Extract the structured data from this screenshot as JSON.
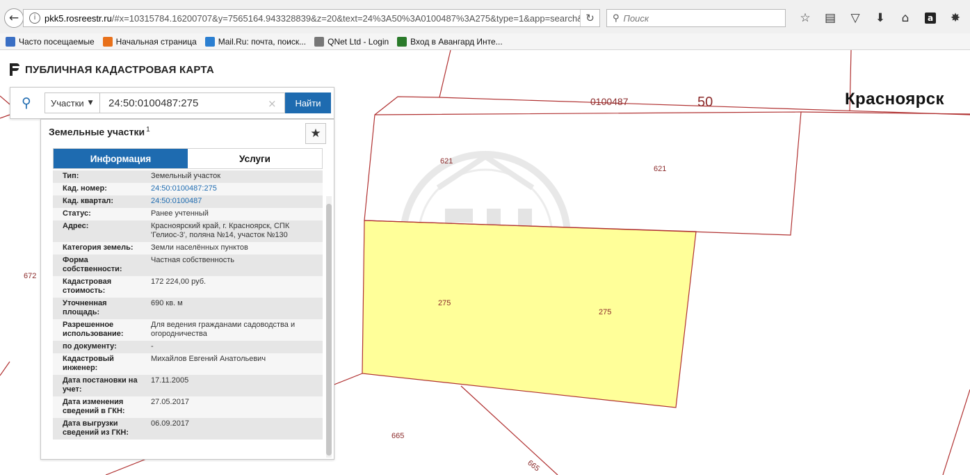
{
  "browser": {
    "url_domain": "pkk5.rosreestr.ru",
    "url_rest": "/#x=10315784.16200707&y=7565164.943328839&z=20&text=24%3A50%3A0100487%3A275&type=1&app=search&o",
    "search_placeholder": "Поиск",
    "bookmarks": [
      {
        "label": "Часто посещаемые",
        "icon": "folder-icon",
        "color": "#3a6fc4"
      },
      {
        "label": "Начальная страница",
        "icon": "firefox-icon",
        "color": "#e8711b"
      },
      {
        "label": "Mail.Ru: почта, поиск...",
        "icon": "mailru-icon",
        "color": "#2b7fd1"
      },
      {
        "label": "QNet Ltd - Login",
        "icon": "globe-icon",
        "color": "#777777"
      },
      {
        "label": "Вход в Авангард Инте...",
        "icon": "bank-icon",
        "color": "#2a7a2a"
      }
    ]
  },
  "app": {
    "title": "ПУБЛИЧНАЯ КАДАСТРОВАЯ КАРТА"
  },
  "search": {
    "type_label": "Участки",
    "query": "24:50:0100487:275",
    "find_label": "Найти"
  },
  "panel": {
    "title": "Земельные участки",
    "count": "1",
    "tabs": [
      "Информация",
      "Услуги"
    ],
    "rows": [
      {
        "key": "Тип:",
        "value": "Земельный участок",
        "link": false
      },
      {
        "key": "Кад. номер:",
        "value": "24:50:0100487:275",
        "link": true
      },
      {
        "key": "Кад. квартал:",
        "value": "24:50:0100487",
        "link": true
      },
      {
        "key": "Статус:",
        "value": "Ранее учтенный",
        "link": false
      },
      {
        "key": "Адрес:",
        "value": "Красноярский край, г. Красноярск, СПК 'Гелиос-3', поляна №14, участок №130",
        "link": false
      },
      {
        "key": "Категория земель:",
        "value": "Земли населённых пунктов",
        "link": false
      },
      {
        "key": "Форма собственности:",
        "value": "Частная собственность",
        "link": false
      },
      {
        "key": "Кадастровая стоимость:",
        "value": "172 224,00 руб.",
        "link": false
      },
      {
        "key": "Уточненная площадь:",
        "value": "690 кв. м",
        "link": false
      },
      {
        "key": "Разрешенное использование:",
        "value": "Для ведения гражданами садоводства и огородничества",
        "link": false
      },
      {
        "key": "по документу:",
        "value": "-",
        "link": false
      },
      {
        "key": "Кадастровый инженер:",
        "value": "Михайлов Евгений Анатольевич",
        "link": false
      },
      {
        "key": "Дата постановки на учет:",
        "value": "17.11.2005",
        "link": false
      },
      {
        "key": "Дата изменения сведений в ГКН:",
        "value": "27.05.2017",
        "link": false
      },
      {
        "key": "Дата выгрузки сведений из ГКН:",
        "value": "06.09.2017",
        "link": false
      }
    ]
  },
  "map": {
    "quarter_label": "0100487",
    "district_label": "50",
    "city_label": "Красноярск",
    "parcel_labels": [
      "621",
      "621",
      "275",
      "275",
      "672",
      "665",
      "665"
    ],
    "selected_fill": "#ffff99",
    "boundary_color": "#b03030",
    "watermark": "Suvorov Home"
  }
}
